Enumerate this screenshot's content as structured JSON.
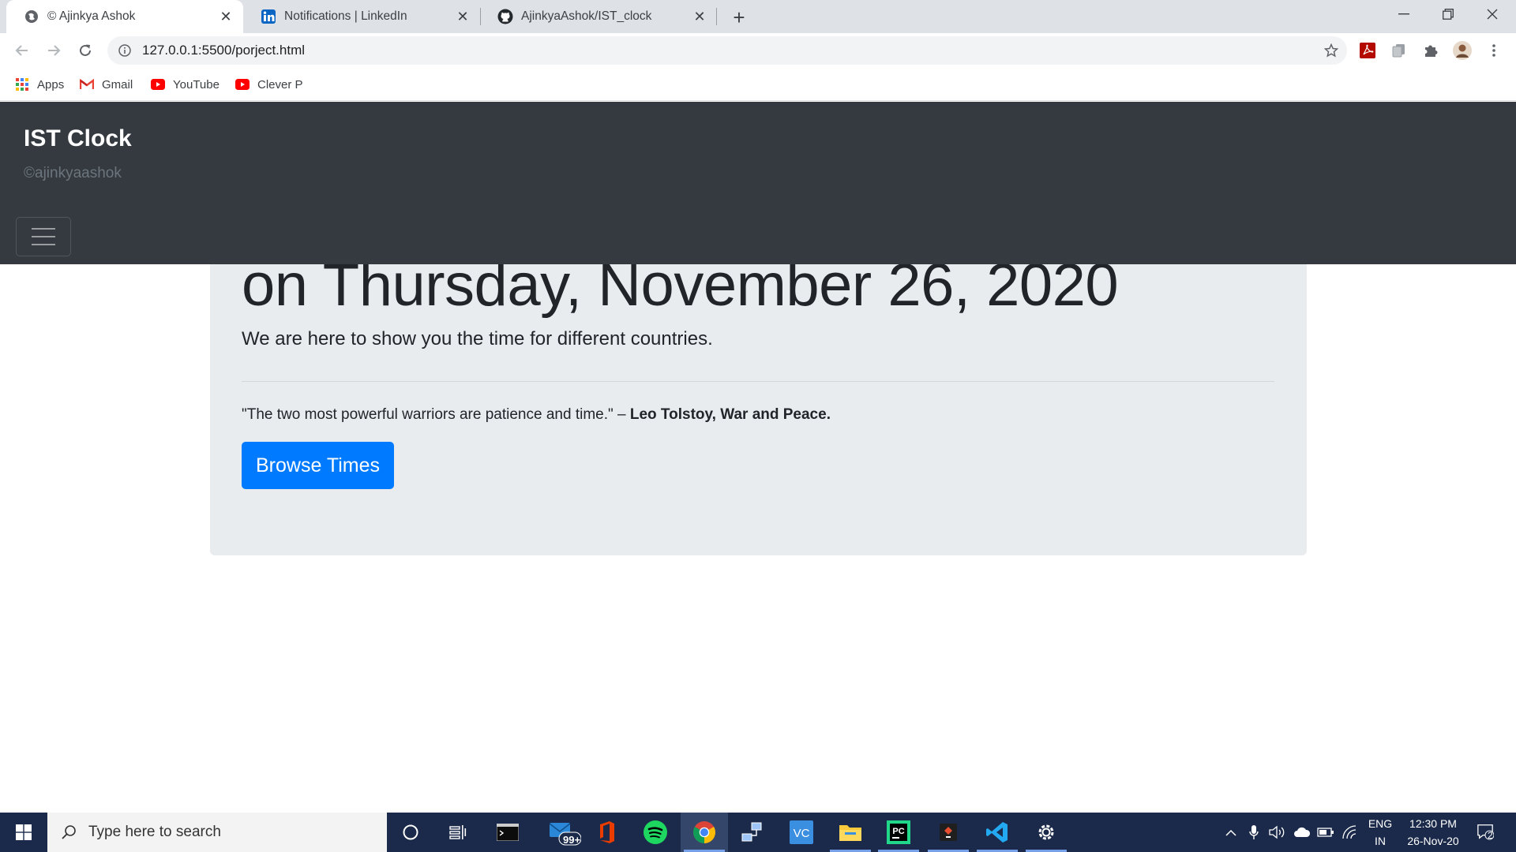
{
  "browser": {
    "tabs": [
      {
        "title": "© Ajinkya Ashok",
        "icon": "globe-icon",
        "active": true
      },
      {
        "title": "Notifications | LinkedIn",
        "icon": "linkedin-icon",
        "active": false
      },
      {
        "title": "AjinkyaAshok/IST_clock",
        "icon": "github-icon",
        "active": false
      }
    ],
    "new_tab_label": "+",
    "url": "127.0.0.1:5500/porject.html",
    "bookmarks": [
      {
        "label": "Apps",
        "icon": "apps-grid-icon"
      },
      {
        "label": "Gmail",
        "icon": "gmail-icon"
      },
      {
        "label": "YouTube",
        "icon": "youtube-icon"
      },
      {
        "label": "Clever P",
        "icon": "youtube-icon"
      }
    ]
  },
  "page": {
    "navbar": {
      "brand": "IST Clock",
      "subtitle": "©ajinkyaashok"
    },
    "jumbotron": {
      "heading": "on Thursday, November 26, 2020",
      "lead": "We are here to show you the time for different countries.",
      "quote_text": "\"The two most powerful warriors are patience and time.\" – ",
      "quote_author": "Leo Tolstoy, War and Peace.",
      "button_label": "Browse Times"
    }
  },
  "taskbar": {
    "search_placeholder": "Type here to search",
    "mail_badge": "99+",
    "language_top": "ENG",
    "language_bottom": "IN",
    "time": "12:30 PM",
    "date": "26-Nov-20",
    "notification_count": "2"
  },
  "colors": {
    "navbar_bg": "#343a40",
    "jumbotron_bg": "#e9ecef",
    "primary_button": "#007bff",
    "taskbar_bg": "#1b2a4a"
  }
}
